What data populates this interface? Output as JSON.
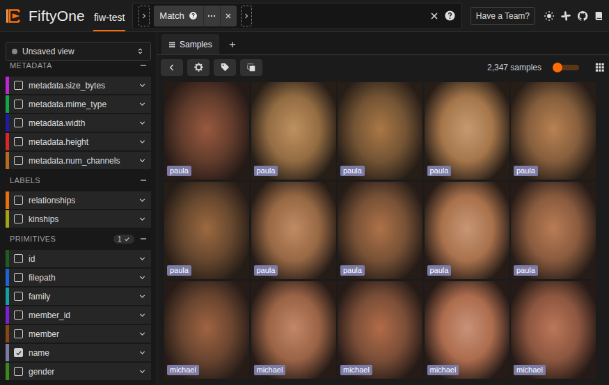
{
  "header": {
    "logo": "FiftyOne",
    "dataset": "fiw-test",
    "stages": [
      {
        "label": "Match"
      }
    ],
    "team_button": "Have a Team?"
  },
  "sidebar": {
    "view": "Unsaved view",
    "sections": [
      {
        "title": "METADATA",
        "fields": [
          {
            "label": "metadata.size_bytes",
            "checked": false,
            "color": "#c026d3"
          },
          {
            "label": "metadata.mime_type",
            "checked": false,
            "color": "#16a34a"
          },
          {
            "label": "metadata.width",
            "checked": false,
            "color": "#1e1ba8"
          },
          {
            "label": "metadata.height",
            "checked": false,
            "color": "#dc2626"
          },
          {
            "label": "metadata.num_channels",
            "checked": false,
            "color": "#b86a1e"
          }
        ]
      },
      {
        "title": "LABELS",
        "fields": [
          {
            "label": "relationships",
            "checked": false,
            "color": "#e8700a"
          },
          {
            "label": "kinships",
            "checked": false,
            "color": "#a3a314"
          }
        ]
      },
      {
        "title": "PRIMITIVES",
        "badge": "1",
        "fields": [
          {
            "label": "id",
            "checked": false,
            "color": "#1f5d1f"
          },
          {
            "label": "filepath",
            "checked": false,
            "color": "#1d64d8"
          },
          {
            "label": "family",
            "checked": false,
            "color": "#14a0a0"
          },
          {
            "label": "member_id",
            "checked": false,
            "color": "#7c1fd6"
          },
          {
            "label": "member",
            "checked": false,
            "color": "#8b4513"
          },
          {
            "label": "name",
            "checked": true,
            "color": "#7b7ba6"
          },
          {
            "label": "gender",
            "checked": false,
            "color": "#3a8a1a"
          }
        ]
      }
    ]
  },
  "tabs": [
    {
      "label": "Samples",
      "selected": true
    }
  ],
  "toolbar": {
    "count": "2,347 samples",
    "zoom": {
      "level": 0.15
    }
  },
  "samples": [
    {
      "label": "paula"
    },
    {
      "label": "paula"
    },
    {
      "label": "paula"
    },
    {
      "label": "paula"
    },
    {
      "label": "paula"
    },
    {
      "label": "paula"
    },
    {
      "label": "paula"
    },
    {
      "label": "paula"
    },
    {
      "label": "paula"
    },
    {
      "label": "paula"
    },
    {
      "label": "michael"
    },
    {
      "label": "michael"
    },
    {
      "label": "michael"
    },
    {
      "label": "michael"
    },
    {
      "label": "michael"
    }
  ]
}
